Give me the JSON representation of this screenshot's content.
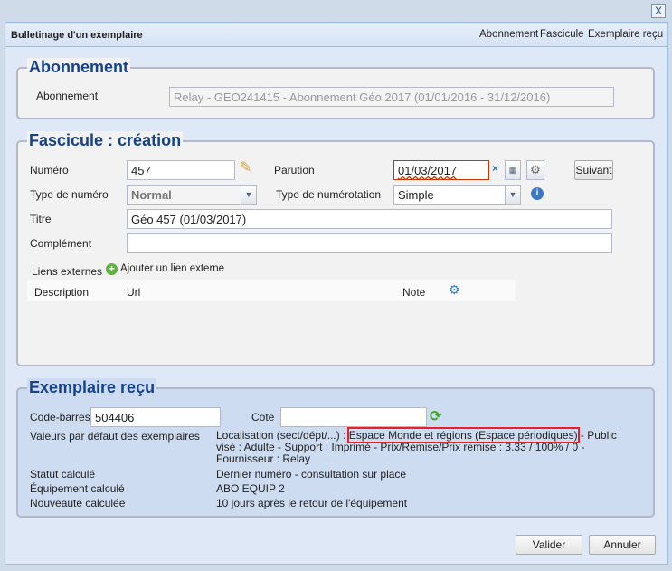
{
  "window": {
    "title": "Bulletinage d'un exemplaire",
    "close": "X",
    "nav": [
      "Abonnement",
      "Fascicule",
      "Exemplaire reçu"
    ]
  },
  "abonnement": {
    "legend": "Abonnement",
    "label": "Abonnement",
    "value": "Relay - GEO241415 - Abonnement Géo 2017 (01/01/2016 - 31/12/2016)"
  },
  "fascicule": {
    "legend": "Fascicule : création",
    "numero_label": "Numéro",
    "numero": "457",
    "parution_label": "Parution",
    "parution": "01/03/2017",
    "clear": "×",
    "suivant": "Suivant",
    "type_numero_label": "Type de numéro",
    "type_numero": "Normal",
    "type_numerotation_label": "Type de numérotation",
    "type_numerotation": "Simple",
    "titre_label": "Titre",
    "titre": "Géo 457 (01/03/2017)",
    "complement_label": "Complément",
    "complement": "",
    "liens_label": "Liens externes",
    "add_link": "Ajouter un lien externe",
    "columns": [
      "Description",
      "Url",
      "Note"
    ]
  },
  "exemplaire": {
    "legend": "Exemplaire reçu",
    "codebarres_label": "Code-barres",
    "codebarres": "504406",
    "cote_label": "Cote",
    "cote": "",
    "defaults_label": "Valeurs par défaut des exemplaires",
    "defaults_pre": "Localisation (sect/dépt/...) : ",
    "defaults_highlight": "Espace Monde et régions (Espace périodiques)",
    "defaults_post": " - Public visé : Adulte - Support : Imprimé - Prix/Remise/Prix remise : 3.33 / 100% / 0 - Fournisseur : Relay",
    "highlight_color": "#e8202a",
    "rows": [
      {
        "label": "Statut calculé",
        "value": "Dernier numéro - consultation sur place"
      },
      {
        "label": "Équipement calculé",
        "value": "ABO EQUIP 2"
      },
      {
        "label": "Nouveauté calculée",
        "value": "10 jours après le retour de l'équipement"
      }
    ]
  },
  "buttons": {
    "validate": "Valider",
    "cancel": "Annuler"
  }
}
